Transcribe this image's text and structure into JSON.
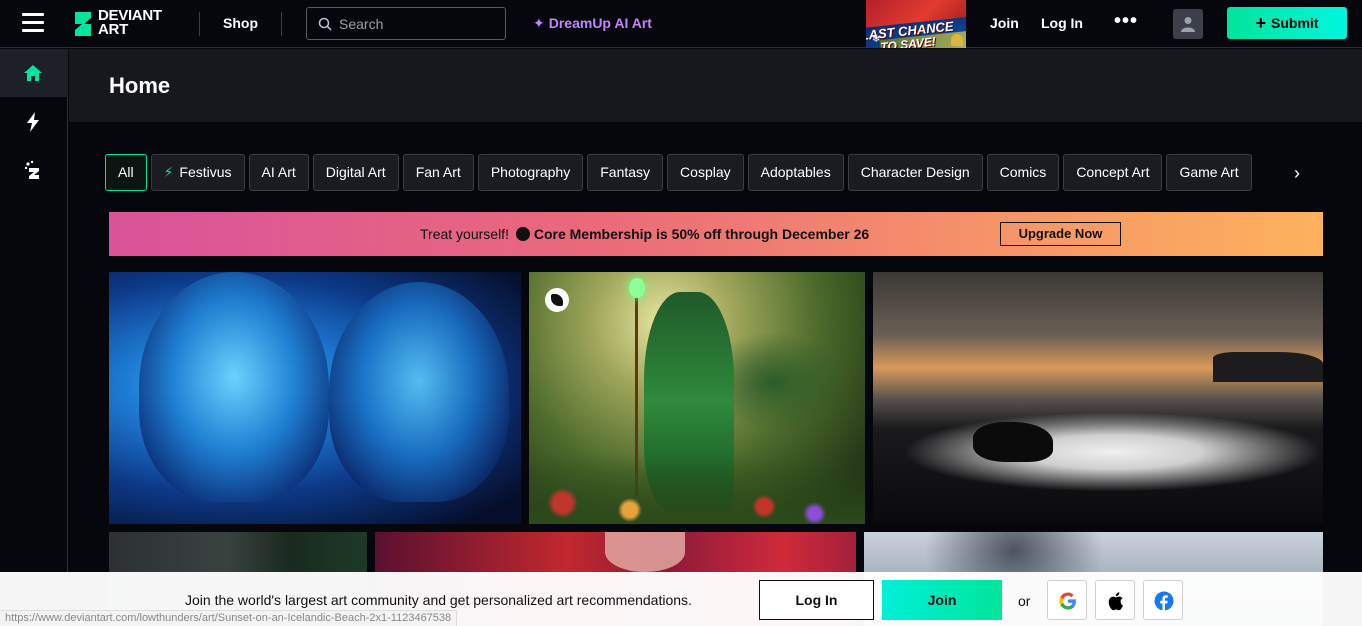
{
  "header": {
    "logo_line1": "DEVIANT",
    "logo_line2": "ART",
    "shop_label": "Shop",
    "search_placeholder": "Search",
    "dreamup_label": "DreamUp AI Art",
    "ad_line1": "LAST CHANCE",
    "ad_line2": "TO SAVE!",
    "join_label": "Join",
    "login_label": "Log In",
    "more_label": "•••",
    "submit_label": "Submit"
  },
  "sidebar": {
    "items": [
      {
        "icon": "home-icon",
        "active": true
      },
      {
        "icon": "lightning-icon",
        "active": false
      },
      {
        "icon": "dreamup-icon",
        "active": false
      }
    ]
  },
  "page": {
    "title": "Home"
  },
  "chips": [
    "All",
    "Festivus",
    "AI Art",
    "Digital Art",
    "Fan Art",
    "Photography",
    "Fantasy",
    "Cosplay",
    "Adoptables",
    "Character Design",
    "Comics",
    "Concept Art",
    "Game Art"
  ],
  "banner": {
    "lead": "Treat yourself!",
    "offer": "Core Membership is 50% off through December 26",
    "cta": "Upgrade Now"
  },
  "join_bar": {
    "text": "Join the world's largest art community and get personalized art recommendations.",
    "login_label": "Log In",
    "join_label": "Join",
    "or_label": "or"
  },
  "status_url": "https://www.deviantart.com/lowthunders/art/Sunset-on-an-Icelandic-Beach-2x1-1123467538",
  "colors": {
    "accent": "#00e59b",
    "dreamup": "#c084fc",
    "background": "#06070d"
  }
}
